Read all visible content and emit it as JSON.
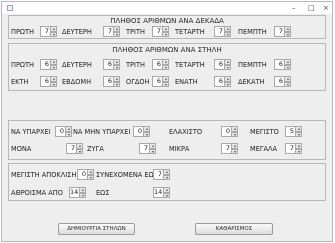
{
  "window": {
    "minimize": "–",
    "maximize": "□",
    "close": "×"
  },
  "decades": {
    "title": "ΠΛΗΘΟΣ ΑΡΙΘΜΩΝ ΑΝΑ ΔΕΚΑΔΑ",
    "fields": [
      {
        "label": "ΠΡΩΤΗ",
        "value": "7"
      },
      {
        "label": "ΔΕΥΤΕΡΗ",
        "value": "7"
      },
      {
        "label": "ΤΡΙΤΗ",
        "value": "7"
      },
      {
        "label": "ΤΕΤΑΡΤΗ",
        "value": "7"
      },
      {
        "label": "ΠΕΜΠΤΗ",
        "value": "7"
      }
    ]
  },
  "columns": {
    "title": "ΠΛΗΘΟΣ ΑΡΙΘΜΩΝ ΑΝΑ ΣΤΗΛΗ",
    "row1": [
      {
        "label": "ΠΡΩΤΗ",
        "value": "6"
      },
      {
        "label": "ΔΕΥΤΕΡΗ",
        "value": "6"
      },
      {
        "label": "ΤΡΙΤΗ",
        "value": "6"
      },
      {
        "label": "ΤΕΤΑΡΤΗ",
        "value": "6"
      },
      {
        "label": "ΠΕΜΠΤΗ",
        "value": "6"
      }
    ],
    "row2": [
      {
        "label": "ΕΚΤΗ",
        "value": "6"
      },
      {
        "label": "ΕΒΔΟΜΗ",
        "value": "6"
      },
      {
        "label": "ΟΓΔΟΗ",
        "value": "6"
      },
      {
        "label": "ΕΝΑΤΗ",
        "value": "6"
      },
      {
        "label": "ΔΕΚΑΤΗ",
        "value": "6"
      }
    ]
  },
  "filters": {
    "row1": [
      {
        "label": "ΝΑ ΥΠΑΡΧΕΙ",
        "value": "0"
      },
      {
        "label": "ΝΑ ΜΗΝ ΥΠΑΡΧΕΙ",
        "value": "0"
      },
      {
        "label": "ΕΛΑΧΙΣΤΟ",
        "value": "0"
      },
      {
        "label": "ΜΕΓΙΣΤΟ",
        "value": "5"
      }
    ],
    "row2": [
      {
        "label": "ΜΟΝΑ",
        "value": "7"
      },
      {
        "label": "ΖΥΓΑ",
        "value": "7"
      },
      {
        "label": "ΜΙΚΡΑ",
        "value": "7"
      },
      {
        "label": "ΜΕΓΑΛΑ",
        "value": "7"
      }
    ]
  },
  "limits": {
    "max_distance": {
      "label": "ΜΕΓΙΣΤΗ ΑΠΟΚΛΙΣΗ",
      "value": "0"
    },
    "consecutive": {
      "label": "ΣΥΝΕΧΟΜΕΝΑ ΕΩΣ",
      "value": "7"
    },
    "sum_from": {
      "label": "ΑΘΡΟΙΣΜΑ ΑΠΟ",
      "value": "14"
    },
    "sum_to": {
      "label": "ΕΩΣ",
      "value": "14"
    }
  },
  "buttons": {
    "create": "ΔΗΜΙΟΥΡΓΙΑ ΣΤΗΛΩΝ",
    "clear": "ΚΑΘΑΡΙΣΜΟΣ"
  }
}
